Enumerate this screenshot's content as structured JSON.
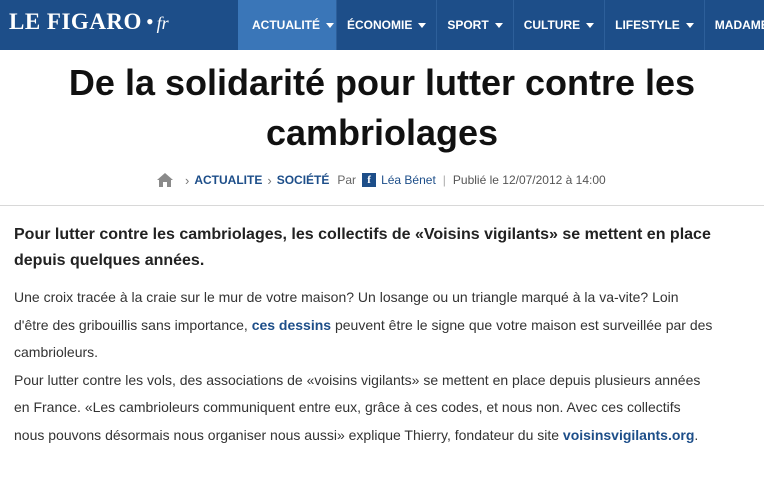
{
  "header": {
    "logo_main": "LE FIGARO",
    "logo_dot": "•",
    "logo_fr": "fr",
    "nav": [
      {
        "label": "ACTUALITÉ",
        "active": true
      },
      {
        "label": "ÉCONOMIE"
      },
      {
        "label": "SPORT"
      },
      {
        "label": "CULTURE"
      },
      {
        "label": "LIFESTYLE"
      },
      {
        "label": "MADAME"
      }
    ]
  },
  "article": {
    "title_line1": "De la solidarité pour lutter contre les",
    "title_line2": "cambriolages",
    "breadcrumb": {
      "section": "ACTUALITE",
      "subsection": "SOCIÉTÉ",
      "by": "Par",
      "author": "Léa Bénet",
      "published": "Publié le 12/07/2012 à 14:00"
    },
    "lead": "Pour lutter contre les cambriolages, les collectifs de «Voisins vigilants» se mettent en place   depuis quelques années.",
    "p1_before": "Une croix tracée à la craie sur le mur de votre maison? Un losange ou un triangle marqué à la va-vite? Loin d'être des gribouillis sans importance, ",
    "p1_link": "ces dessins",
    "p1_after": " peuvent être le signe que votre maison est surveillée par des cambrioleurs.",
    "p2_before": "Pour lutter contre les vols, des associations de «voisins vigilants» se mettent en place depuis plusieurs années en France.  «Les cambrioleurs communiquent entre eux, grâce à ces codes, et nous non. Avec ces collectifs nous pouvons désormais nous organiser nous aussi» explique Thierry, fondateur du site ",
    "p2_link": "voisinsvigilants.org",
    "p2_after": "."
  },
  "colors": {
    "brand": "#1d4e89",
    "nav_active": "#3a76b8"
  }
}
